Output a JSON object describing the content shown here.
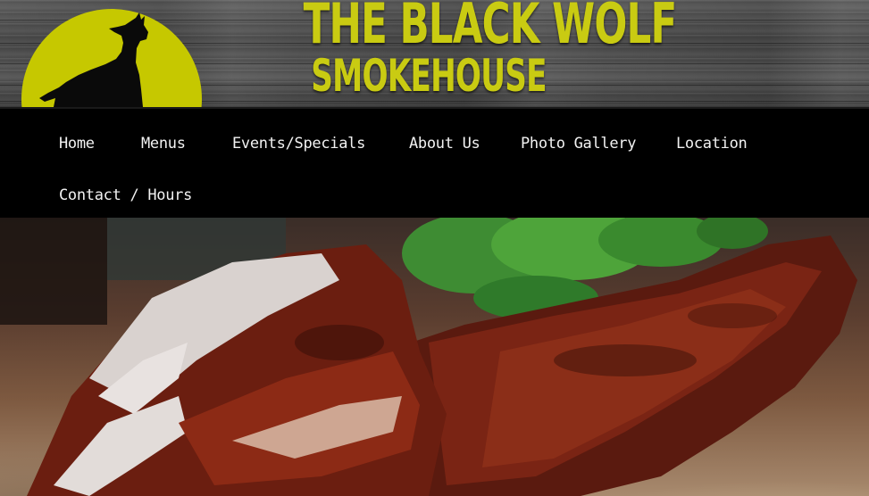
{
  "brand": {
    "name_line1": "THE BLACK WOLF",
    "name_line2": "SMOKEHOUSE",
    "logo_icon": "howling-wolf-moon-icon",
    "accent_color": "#c6c800"
  },
  "nav": {
    "items": [
      {
        "label": "Home"
      },
      {
        "label": "Menus"
      },
      {
        "label": "Events/Specials"
      },
      {
        "label": "About Us"
      },
      {
        "label": "Photo Gallery"
      },
      {
        "label": "Location"
      },
      {
        "label": "Contact / Hours"
      }
    ]
  },
  "hero": {
    "image": "smoked-ribs-photo"
  }
}
